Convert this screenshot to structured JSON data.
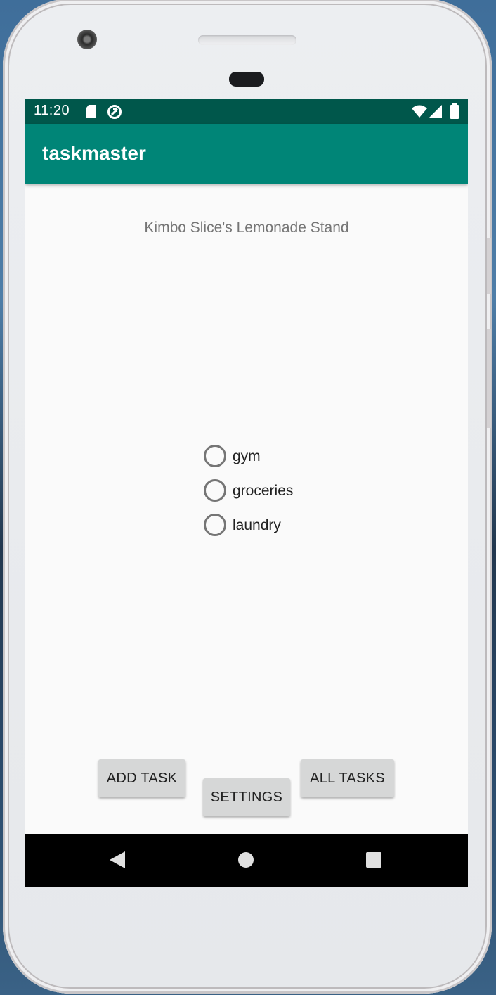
{
  "status_bar": {
    "time": "11:20",
    "icons": [
      "sd-card-icon",
      "sync-icon",
      "wifi-icon",
      "cell-signal-icon",
      "battery-icon"
    ]
  },
  "app_bar": {
    "title": "taskmaster",
    "color": "#008577"
  },
  "main": {
    "team_name": "Kimbo Slice's Lemonade Stand",
    "tasks": [
      {
        "label": "gym",
        "selected": false
      },
      {
        "label": "groceries",
        "selected": false
      },
      {
        "label": "laundry",
        "selected": false
      }
    ]
  },
  "buttons": {
    "add_task": "ADD TASK",
    "settings": "SETTINGS",
    "all_tasks": "ALL TASKS"
  },
  "nav_bar": {
    "icons": [
      "back-icon",
      "home-icon",
      "recents-icon"
    ]
  },
  "colors": {
    "status_bar": "#00574b",
    "app_bar": "#008577",
    "button": "#d6d7d7"
  }
}
